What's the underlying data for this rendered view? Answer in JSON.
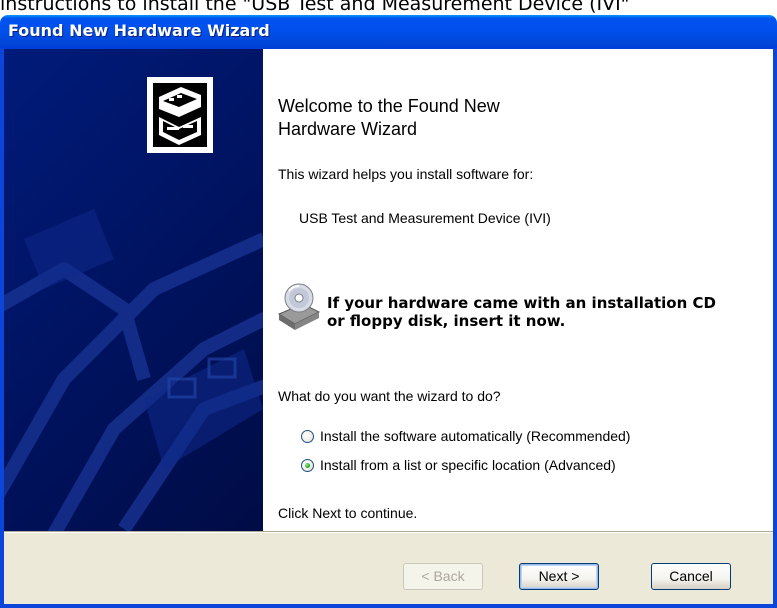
{
  "page": {
    "caption": "instructions to install the \"USB Test and Measurement Device (IVI\""
  },
  "window": {
    "title": "Found New Hardware Wizard"
  },
  "content": {
    "welcome_line1": "Welcome to the Found New",
    "welcome_line2": "Hardware Wizard",
    "description": "This wizard helps you install software for:",
    "device_name": "USB Test and Measurement Device (IVI)",
    "cd_prompt_line1": "If your hardware came with an installation CD",
    "cd_prompt_line2": "or floppy disk, insert it now.",
    "question": "What do you want the wizard to do?",
    "options": [
      {
        "label": "Install the software automatically (Recommended)",
        "selected": false
      },
      {
        "label": "Install from a list or specific location (Advanced)",
        "selected": true
      }
    ],
    "footer": "Click Next to continue."
  },
  "buttons": {
    "back": "< Back",
    "next": "Next >",
    "cancel": "Cancel"
  },
  "colors": {
    "titlebar": "#0053ee",
    "banner": "#00125e",
    "dialog_face": "#ece9d8",
    "radio_selected": "#27a527"
  },
  "icons": {
    "wizard": "hardware-box-icon",
    "cd": "cd-drive-icon"
  }
}
